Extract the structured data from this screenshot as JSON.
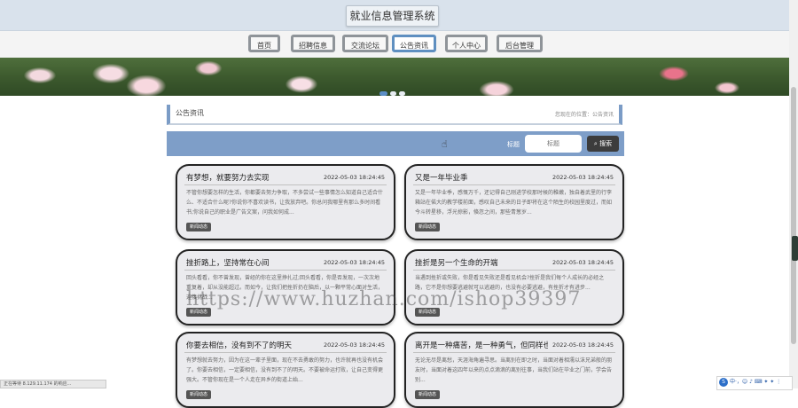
{
  "site": {
    "title": "就业信息管理系统"
  },
  "nav": {
    "items": [
      {
        "label": "首页"
      },
      {
        "label": "招聘信息"
      },
      {
        "label": "交流论坛"
      },
      {
        "label": "公告资讯"
      },
      {
        "label": "个人中心"
      },
      {
        "label": "后台管理"
      }
    ],
    "active_index": 3
  },
  "section": {
    "title": "公告资讯",
    "breadcrumb": "您现在的位置：公告资讯"
  },
  "search": {
    "label": "标题",
    "placeholder": "标题",
    "button_label": "搜索"
  },
  "cards": [
    {
      "title": "有梦想，就要努力去实现",
      "date": "2022-05-03 18:24:45",
      "summary": "不管你想要怎样的生活，你都要去努力争取，不多尝试一些事情怎么知道自己适合什么、不适合什么呢?你说你不喜欢读书，让我放弃吧。你总问我哪里有那么多时间看书;你说自己的职业是广告文案，问我如何成...",
      "tag": "新闻动态"
    },
    {
      "title": "又是一年毕业季",
      "date": "2022-05-03 18:24:45",
      "summary": "又是一年毕业季，感慨万千，还记得自己刚进学校那时候的稚嫩，独自着武里的行李箱站在偌大的教学楼前面，感叹自己未来的日子即将在这个陌生的校园里度过，而如今斗转星移，浮光掠影，倏忽之间，那些青葱岁...",
      "tag": "新闻动态"
    },
    {
      "title": "挫折路上，坚持常在心间",
      "date": "2022-05-03 18:24:45",
      "summary": "回头看看，你不曾发现，曾经的你在这里挣扎过;回头看看，你是否发现，一次次地重复着，却从没能超过。而如今，让我们把挫折扔在脑后，以一颗平常心面对生活，迎接挑战...",
      "tag": "新闻动态"
    },
    {
      "title": "挫折是另一个生命的开端",
      "date": "2022-05-03 18:24:45",
      "summary": "当遇到挫折或失败，你是看见失败还是看见机会?挫折是我们每个人成长的必经之路，它不是你想要逃避就可以逃避的，也没有必要逃避，有挫折才有进步...",
      "tag": "新闻动态"
    },
    {
      "title": "你要去相信，没有到不了的明天",
      "date": "2022-05-03 18:24:45",
      "summary": "有梦想就去努力，因为在这一辈子里面，现在不去勇敢的努力，也许就再也没有机会了。你要去相信，一定要相信，没有到不了的明天。不要被命运打败，让自己变得更强大。不管你现在是一个人走在异乡的街道上始...",
      "tag": "新闻动态"
    },
    {
      "title": "离开是一种痛苦，是一种勇气，但同样也是一种收获",
      "date": "2022-05-03 18:24:45",
      "summary": "无论无尽是离愁，天涯海角遍寻思。当离别在即之时，当面对着相濡以沫兄弟般的朋友时，当面对着这四年以来的点点滴滴的离别往事，当我们站在毕业之门前，学会告别...",
      "tag": "新闻动态"
    }
  ],
  "watermark": "https://www.huzhan.com/ishop39397",
  "status": {
    "text": "正在等待 8.129.11.174 的响应..."
  },
  "ime": {
    "logo": "S",
    "text": "中·，☺ ♪ ⌨ ✦ ✦ ⋮"
  },
  "colors": {
    "accent": "#7b9cc6",
    "search_bar": "#7e9ec8",
    "button_dark": "#3c3c3c",
    "active_nav_border": "#5f8fc0"
  }
}
